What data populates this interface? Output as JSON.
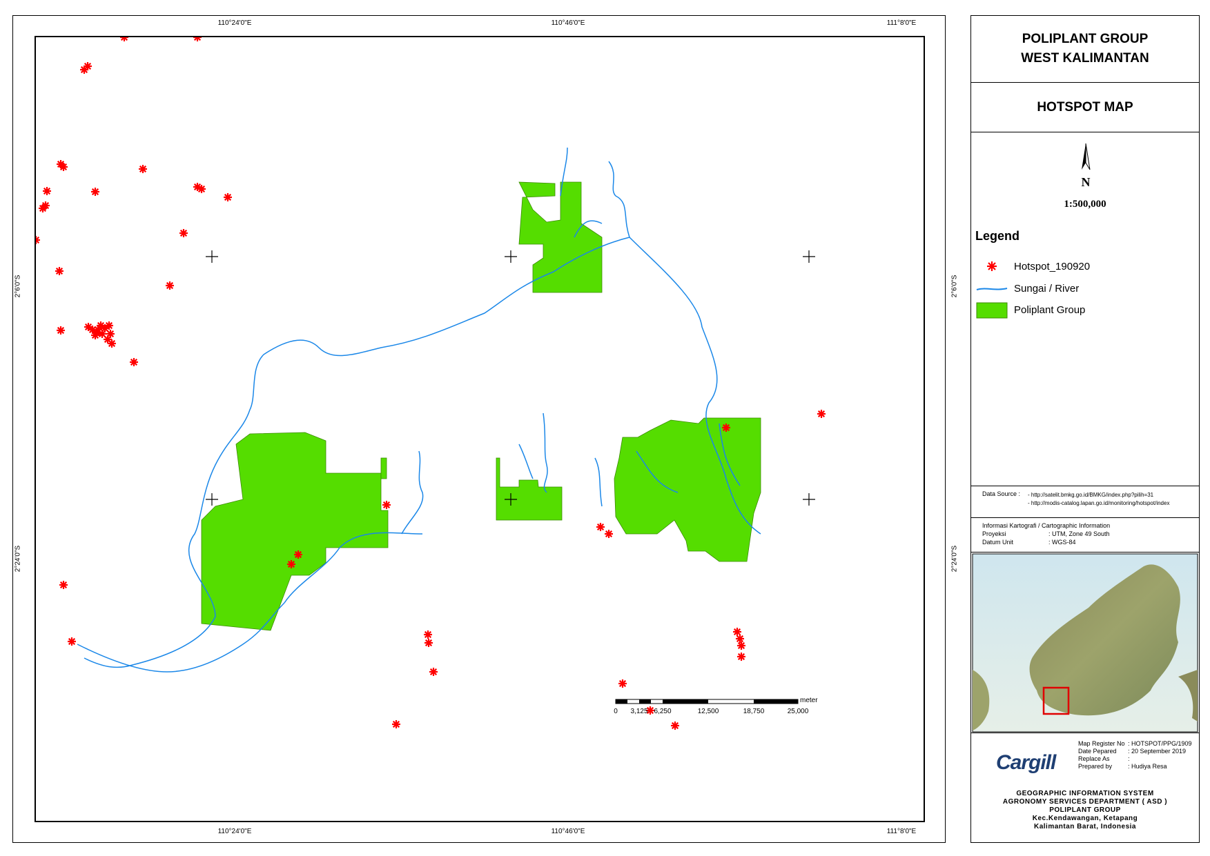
{
  "map": {
    "coords_top": [
      "110°24'0\"E",
      "110°46'0\"E",
      "111°8'0\"E"
    ],
    "coords_bottom": [
      "110°24'0\"E",
      "110°46'0\"E",
      "111°8'0\"E"
    ],
    "coords_left": [
      "2°6'0\"S",
      "2°24'0\"S"
    ],
    "coords_right": [
      "2°6'0\"S",
      "2°24'0\"S"
    ],
    "scalebar": {
      "unit": "meter",
      "ticks": [
        "0",
        "3,125",
        "6,250",
        "12,500",
        "18,750",
        "25,000"
      ]
    },
    "colors": {
      "hotspot": "#ff0000",
      "river": "#1a87e8",
      "plantation": "#55dd00",
      "plantation_edge": "#3a8a00"
    }
  },
  "panel": {
    "title_line1": "POLIPLANT GROUP",
    "title_line2": "WEST KALIMANTAN",
    "map_title": "HOTSPOT MAP",
    "north_label": "N",
    "scale": "1:500,000",
    "legend_title": "Legend",
    "legend_items": [
      {
        "label": "Hotspot_190920",
        "icon": "asterisk-icon"
      },
      {
        "label": "Sungai / River",
        "icon": "river-line-icon"
      },
      {
        "label": "Poliplant Group",
        "icon": "green-fill-icon"
      }
    ],
    "data_source_label": "Data Source :",
    "data_source_1": "- http://satelit.bmkg.go.id/BMKG/index.php?pilih=31",
    "data_source_2": "- http://modis-catalog.lapan.go.id/monitoring/hotspot/index",
    "carto_title": "Informasi Kartografi / Cartographic Information",
    "carto_projection_k": "Proyeksi",
    "carto_projection_v": ": UTM, Zone 49 South",
    "carto_datum_k": "Datum Unit",
    "carto_datum_v": ": WGS-84",
    "logo": "Cargill",
    "register": [
      {
        "k": "Map Register No",
        "v": ": HOTSPOT/PPG/1909"
      },
      {
        "k": "Date Pepared",
        "v": ": 20 September 2019"
      },
      {
        "k": "Replace As",
        "v": ":"
      },
      {
        "k": "Prepared by",
        "v": ": Hudiya Resa"
      }
    ],
    "dept_lines": [
      "GEOGRAPHIC INFORMATION SYSTEM",
      "AGRONOMY SERVICES DEPARTMENT ( ASD )",
      "POLIPLANT GROUP",
      "Kec.Kendawangan, Ketapang",
      "Kalimantan Barat, Indonesia"
    ]
  }
}
